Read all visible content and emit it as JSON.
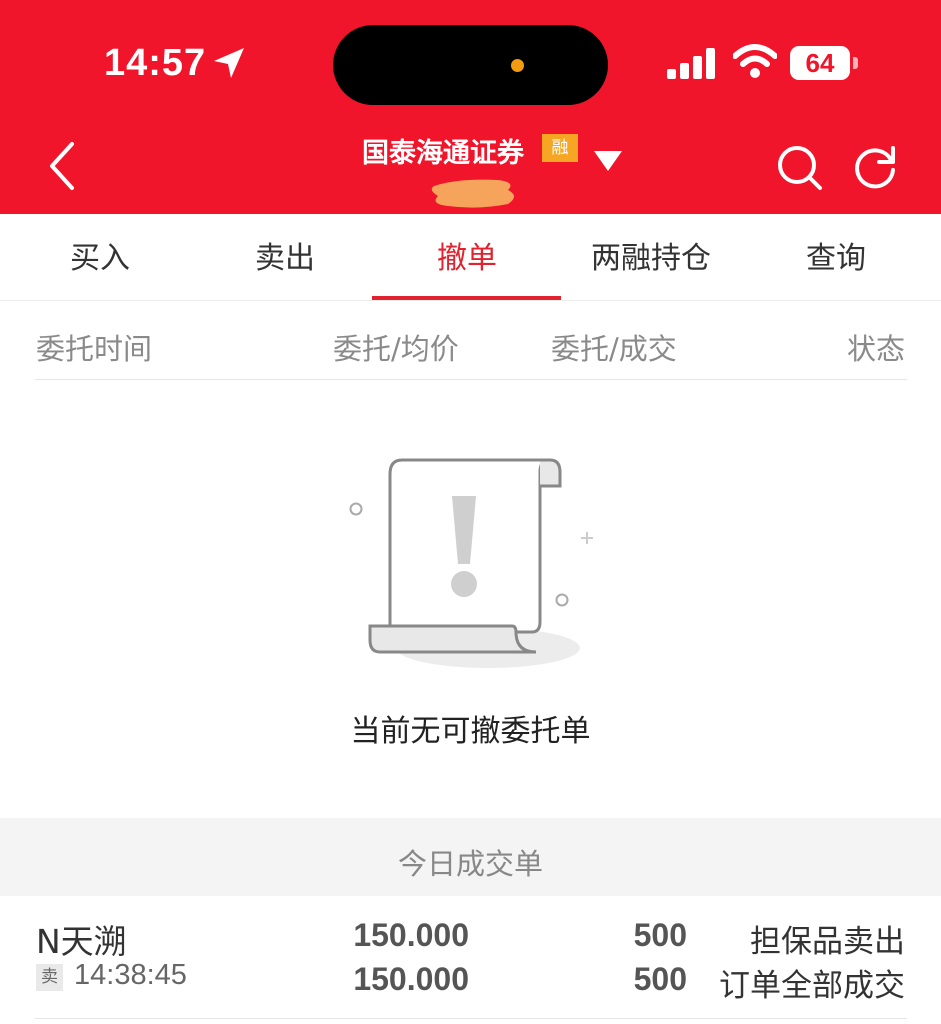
{
  "status_bar": {
    "time": "14:57",
    "battery": "64",
    "icons": [
      "location-arrow-icon",
      "signal-bars-icon",
      "wifi-icon",
      "battery-icon"
    ]
  },
  "header": {
    "title": "国泰海通证券",
    "badge": "融",
    "icons": [
      "back-icon",
      "dropdown-icon",
      "search-icon",
      "refresh-icon"
    ],
    "bg_color": "#f0152a",
    "badge_color": "#f6a623"
  },
  "tabs": [
    {
      "label": "买入"
    },
    {
      "label": "卖出"
    },
    {
      "label": "撤单",
      "active": true
    },
    {
      "label": "两融持仓"
    },
    {
      "label": "查询"
    }
  ],
  "columns": [
    "委托时间",
    "委托/均价",
    "委托/成交",
    "状态"
  ],
  "empty_state": {
    "icon": "empty-document-icon",
    "message": "当前无可撤委托单"
  },
  "today_trades": {
    "title": "今日成交单",
    "rows": [
      {
        "name": "N天溯",
        "side": "卖",
        "time": "14:38:45",
        "order_price": "150.000",
        "avg_price": "150.000",
        "order_qty": "500",
        "filled_qty": "500",
        "type": "担保品卖出",
        "status": "订单全部成交"
      }
    ]
  },
  "accent_color": "#e1232f"
}
